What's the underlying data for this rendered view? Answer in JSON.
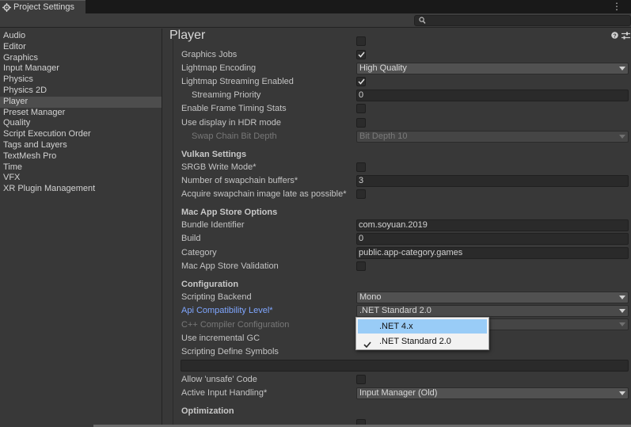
{
  "window": {
    "tab_title": "Project Settings"
  },
  "sidebar": {
    "items": [
      "Audio",
      "Editor",
      "Graphics",
      "Input Manager",
      "Physics",
      "Physics 2D",
      "Player",
      "Preset Manager",
      "Quality",
      "Script Execution Order",
      "Tags and Layers",
      "TextMesh Pro",
      "Time",
      "VFX",
      "XR Plugin Management"
    ],
    "active": "Player"
  },
  "main": {
    "title": "Player",
    "graphics_jobs": "Graphics Jobs",
    "lightmap_encoding": {
      "label": "Lightmap Encoding",
      "value": "High Quality"
    },
    "lightmap_streaming": "Lightmap Streaming Enabled",
    "streaming_priority": {
      "label": "Streaming Priority",
      "value": "0"
    },
    "frame_timing": "Enable Frame Timing Stats",
    "hdr": "Use display in HDR mode",
    "swap_chain": {
      "label": "Swap Chain Bit Depth",
      "value": "Bit Depth 10"
    },
    "vulkan": {
      "header": "Vulkan Settings",
      "srgb": "SRGB Write Mode*",
      "buffers": {
        "label": "Number of swapchain buffers*",
        "value": "3"
      },
      "acquire": "Acquire swapchain image late as possible*"
    },
    "mac": {
      "header": "Mac App Store Options",
      "bundle": {
        "label": "Bundle Identifier",
        "value": "com.soyuan.2019"
      },
      "build": {
        "label": "Build",
        "value": "0"
      },
      "category": {
        "label": "Category",
        "value": "public.app-category.games"
      },
      "validation": "Mac App Store Validation"
    },
    "config": {
      "header": "Configuration",
      "backend": {
        "label": "Scripting Backend",
        "value": "Mono"
      },
      "api": {
        "label": "Api Compatibility Level*",
        "value": ".NET Standard 2.0"
      },
      "cpp": "C++ Compiler Configuration",
      "incremental": "Use incremental GC",
      "defines": "Scripting Define Symbols",
      "unsafe": "Allow 'unsafe' Code",
      "input": {
        "label": "Active Input Handling*",
        "value": "Input Manager (Old)"
      }
    },
    "optimization": {
      "header": "Optimization"
    }
  },
  "popup": {
    "options": [
      ".NET 4.x",
      ".NET Standard 2.0"
    ],
    "highlighted": ".NET 4.x",
    "checked": ".NET Standard 2.0"
  },
  "colors": {
    "highlight_label": "#7fa6ff",
    "popup_selection": "#99ccf7"
  }
}
